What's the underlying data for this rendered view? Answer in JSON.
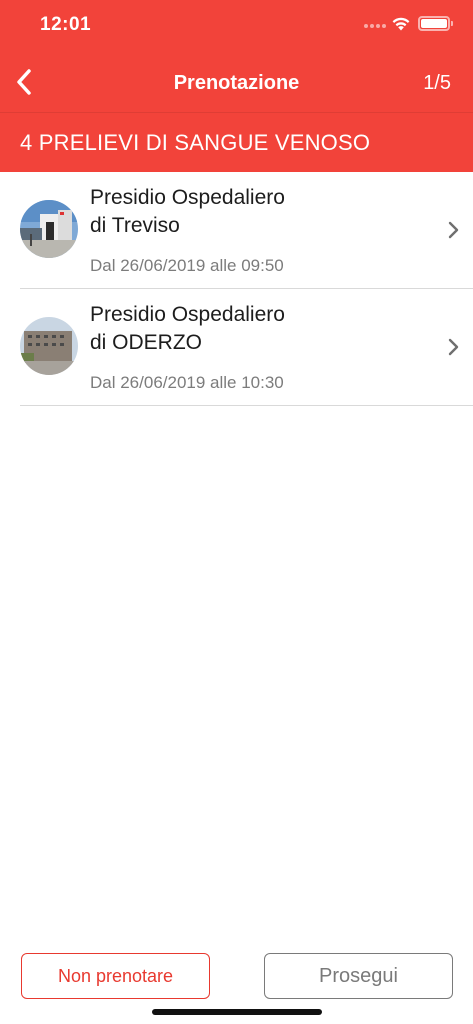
{
  "status_bar": {
    "time": "12:01",
    "icons": [
      "cellular-signal-icon",
      "wifi-icon",
      "battery-icon"
    ]
  },
  "nav": {
    "back_icon": "chevron-left-icon",
    "title": "Prenotazione",
    "step": "1/5"
  },
  "section": {
    "title": "4 PRELIEVI DI SANGUE VENOSO"
  },
  "locations": [
    {
      "title_line1": "Presidio Ospedaliero",
      "title_line2": "di Treviso",
      "date": "Dal 26/06/2019 alle 09:50",
      "icon": "chevron-right-icon"
    },
    {
      "title_line1": "Presidio Ospedaliero",
      "title_line2": "di ODERZO",
      "date": "Dal 26/06/2019 alle 10:30",
      "icon": "chevron-right-icon"
    }
  ],
  "footer": {
    "skip_label": "Non prenotare",
    "next_label": "Prosegui"
  },
  "colors": {
    "brand_red": "#f2433a",
    "button_red": "#e8392f",
    "disabled_gray": "#7a7a7a"
  }
}
